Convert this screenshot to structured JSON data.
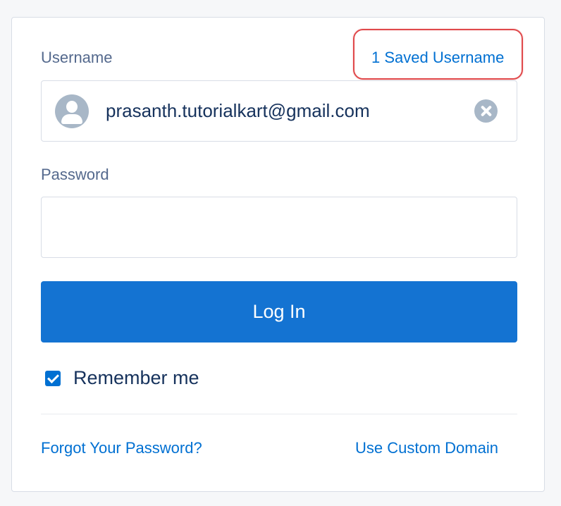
{
  "login_form": {
    "username_label": "Username",
    "saved_username_link": "1 Saved Username",
    "username_value": "prasanth.tutorialkart@gmail.com",
    "password_label": "Password",
    "password_value": "",
    "login_button": "Log In",
    "remember_me": {
      "label": "Remember me",
      "checked": true
    },
    "forgot_password_link": "Forgot Your Password?",
    "custom_domain_link": "Use Custom Domain"
  },
  "icons": {
    "avatar": "user-avatar-icon",
    "clear": "clear-x-icon",
    "checkbox": "checkmark-icon"
  },
  "colors": {
    "link": "#0070d2",
    "button": "#1473d2",
    "label": "#54698d",
    "text": "#16325c",
    "highlight": "#e0484a"
  }
}
